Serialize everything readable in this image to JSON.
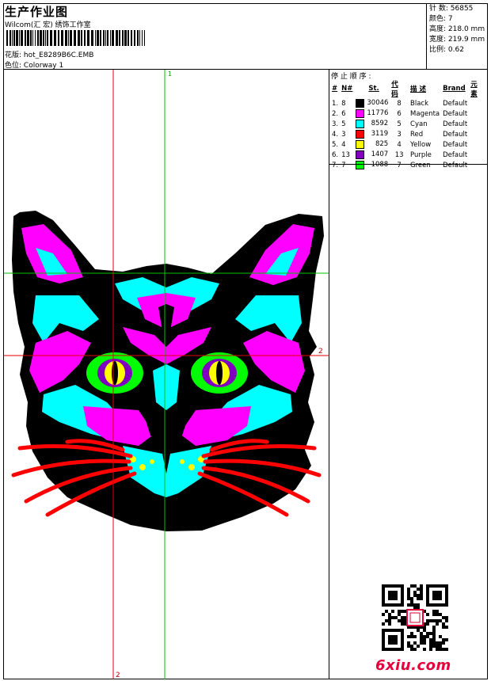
{
  "header": {
    "title": "生产作业图",
    "subtitle": "Wilcom(汇 宏) 绣饰工作室",
    "design_label": "花版:",
    "design_file": "hot_E8289B6C.EMB",
    "colorway_label": "色位:",
    "colorway": "Colorway 1"
  },
  "stats": [
    {
      "label": "针 数:",
      "value": "56855"
    },
    {
      "label": "颜色:",
      "value": "7"
    },
    {
      "label": "高度:",
      "value": "218.0 mm"
    },
    {
      "label": "宽度:",
      "value": "219.9 mm"
    },
    {
      "label": "比例:",
      "value": "0.62"
    }
  ],
  "stop_sequence": {
    "title": "停 止 顺 序 :",
    "columns": [
      "#",
      "N#",
      "St.",
      "代 码",
      "描 述",
      "Brand",
      "元 素"
    ],
    "rows": [
      {
        "idx": "1.",
        "n": "8",
        "st": "30046",
        "code": "8",
        "desc": "Black",
        "brand": "Default",
        "color": "#000000"
      },
      {
        "idx": "2.",
        "n": "6",
        "st": "11776",
        "code": "6",
        "desc": "Magenta",
        "brand": "Default",
        "color": "#ff00ff"
      },
      {
        "idx": "3.",
        "n": "5",
        "st": "8592",
        "code": "5",
        "desc": "Cyan",
        "brand": "Default",
        "color": "#00ffff"
      },
      {
        "idx": "4.",
        "n": "3",
        "st": "3119",
        "code": "3",
        "desc": "Red",
        "brand": "Default",
        "color": "#ff0000"
      },
      {
        "idx": "5.",
        "n": "4",
        "st": "825",
        "code": "4",
        "desc": "Yellow",
        "brand": "Default",
        "color": "#ffff00"
      },
      {
        "idx": "6.",
        "n": "13",
        "st": "1407",
        "code": "13",
        "desc": "Purple",
        "brand": "Default",
        "color": "#8000c0"
      },
      {
        "idx": "7.",
        "n": "7",
        "st": "1088",
        "code": "7",
        "desc": "Green",
        "brand": "Default",
        "color": "#00ff00"
      }
    ]
  },
  "guides": {
    "top": "1",
    "right": "2",
    "bottom": "2"
  },
  "watermark": "6xiu.com",
  "colors": {
    "black": "#000000",
    "magenta": "#ff00ff",
    "cyan": "#00ffff",
    "red": "#ff0000",
    "yellow": "#ffff00",
    "purple": "#8000c0",
    "green": "#00ff00",
    "guide_red": "#e00000",
    "guide_green": "#00c000"
  }
}
